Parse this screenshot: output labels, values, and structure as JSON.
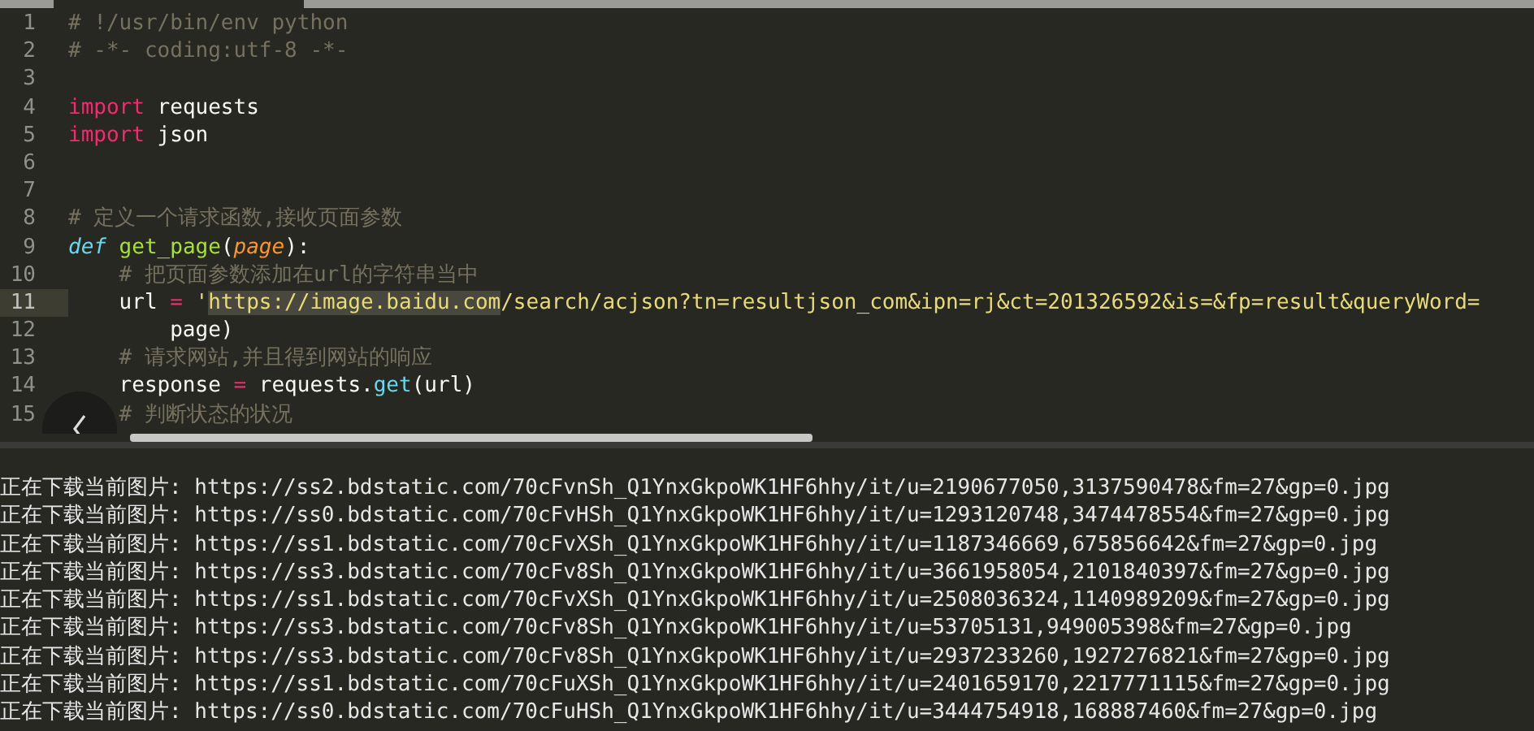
{
  "editor": {
    "lines": [
      {
        "number": "1",
        "current": false,
        "tokens": [
          {
            "text": "# !/usr/bin/env python",
            "kind": "comment"
          }
        ]
      },
      {
        "number": "2",
        "current": false,
        "tokens": [
          {
            "text": "# -*- coding:utf-8 -*-",
            "kind": "comment"
          }
        ]
      },
      {
        "number": "3",
        "current": false
      },
      {
        "number": "4",
        "current": false,
        "tokens": [
          {
            "text": "import",
            "kind": "keyword"
          },
          {
            "text": " requests",
            "kind": "plain"
          }
        ]
      },
      {
        "number": "5",
        "current": false,
        "tokens": [
          {
            "text": "import",
            "kind": "keyword"
          },
          {
            "text": " json",
            "kind": "plain"
          }
        ]
      },
      {
        "number": "6",
        "current": false
      },
      {
        "number": "7",
        "current": false
      },
      {
        "number": "8",
        "current": false,
        "tokens": [
          {
            "text": "# 定义一个请求函数,接收页面参数",
            "kind": "comment"
          }
        ]
      },
      {
        "number": "9",
        "current": false,
        "tokens": [
          {
            "text": "def",
            "kind": "storage"
          },
          {
            "text": " get_page",
            "kind": "function"
          },
          {
            "text": "(",
            "kind": "plain"
          },
          {
            "text": "page",
            "kind": "parameter"
          },
          {
            "text": "):",
            "kind": "plain"
          }
        ]
      },
      {
        "number": "10",
        "current": false,
        "tokens": [
          {
            "text": "    # 把页面参数添加在url的字符串当中",
            "kind": "comment"
          }
        ]
      },
      {
        "number": "11",
        "current": true,
        "tokens": [
          {
            "text": "    url ",
            "kind": "plain"
          },
          {
            "text": "=",
            "kind": "operator"
          },
          {
            "text": " '",
            "kind": "string"
          },
          {
            "text": "https://image.baidu.com",
            "kind": "selection"
          },
          {
            "text": "/search/acjson?tn=resultjson_com&ipn=rj&ct=201326592&is=&fp=result&queryWord=",
            "kind": "string"
          }
        ]
      },
      {
        "number": "12",
        "current": false,
        "tokens": [
          {
            "text": "        page)",
            "kind": "plain"
          }
        ]
      },
      {
        "number": "13",
        "current": false,
        "tokens": [
          {
            "text": "    # 请求网站,并且得到网站的响应",
            "kind": "comment"
          }
        ]
      },
      {
        "number": "14",
        "current": false,
        "tokens": [
          {
            "text": "    response ",
            "kind": "plain"
          },
          {
            "text": "=",
            "kind": "operator"
          },
          {
            "text": " requests.",
            "kind": "plain"
          },
          {
            "text": "get",
            "kind": "method"
          },
          {
            "text": "(url)",
            "kind": "plain"
          }
        ]
      },
      {
        "number": "15",
        "current": false,
        "tokens": [
          {
            "text": "    # 判断状态的状况",
            "kind": "comment"
          }
        ]
      }
    ]
  },
  "output": {
    "lines": [
      "正在下载当前图片: https://ss2.bdstatic.com/70cFvnSh_Q1YnxGkpoWK1HF6hhy/it/u=2190677050,3137590478&fm=27&gp=0.jpg",
      "正在下载当前图片: https://ss0.bdstatic.com/70cFvHSh_Q1YnxGkpoWK1HF6hhy/it/u=1293120748,3474478554&fm=27&gp=0.jpg",
      "正在下载当前图片: https://ss1.bdstatic.com/70cFvXSh_Q1YnxGkpoWK1HF6hhy/it/u=1187346669,675856642&fm=27&gp=0.jpg",
      "正在下载当前图片: https://ss3.bdstatic.com/70cFv8Sh_Q1YnxGkpoWK1HF6hhy/it/u=3661958054,2101840397&fm=27&gp=0.jpg",
      "正在下载当前图片: https://ss1.bdstatic.com/70cFvXSh_Q1YnxGkpoWK1HF6hhy/it/u=2508036324,1140989209&fm=27&gp=0.jpg",
      "正在下载当前图片: https://ss3.bdstatic.com/70cFv8Sh_Q1YnxGkpoWK1HF6hhy/it/u=53705131,949005398&fm=27&gp=0.jpg",
      "正在下载当前图片: https://ss3.bdstatic.com/70cFv8Sh_Q1YnxGkpoWK1HF6hhy/it/u=2937233260,1927276821&fm=27&gp=0.jpg",
      "正在下载当前图片: https://ss1.bdstatic.com/70cFuXSh_Q1YnxGkpoWK1HF6hhy/it/u=2401659170,2217771115&fm=27&gp=0.jpg",
      "正在下载当前图片: https://ss0.bdstatic.com/70cFuHSh_Q1YnxGkpoWK1HF6hhy/it/u=3444754918,168887460&fm=27&gp=0.jpg"
    ]
  }
}
